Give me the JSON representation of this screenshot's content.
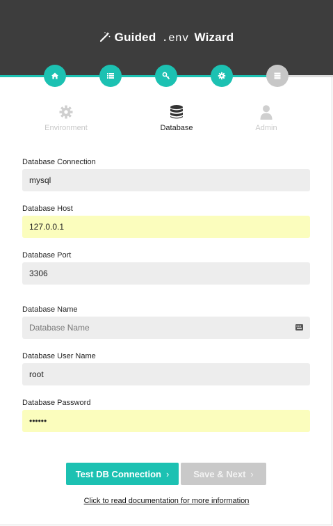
{
  "header": {
    "title_prefix": "Guided",
    "title_code": ".env",
    "title_suffix": "Wizard",
    "icon": "magic-wand-icon"
  },
  "steps": [
    {
      "icon": "home-icon",
      "active": true
    },
    {
      "icon": "list-icon",
      "active": true
    },
    {
      "icon": "key-icon",
      "active": true
    },
    {
      "icon": "gear-icon",
      "active": true
    },
    {
      "icon": "server-icon",
      "active": false
    }
  ],
  "tabs": {
    "environment": {
      "label": "Environment",
      "icon": "gear-icon"
    },
    "database": {
      "label": "Database",
      "icon": "database-icon"
    },
    "admin": {
      "label": "Admin",
      "icon": "user-icon"
    }
  },
  "form": {
    "connection": {
      "label": "Database Connection",
      "value": "mysql"
    },
    "host": {
      "label": "Database Host",
      "value": "127.0.0.1"
    },
    "port": {
      "label": "Database Port",
      "value": "3306"
    },
    "name": {
      "label": "Database Name",
      "value": "",
      "placeholder": "Database Name"
    },
    "user": {
      "label": "Database User Name",
      "value": "root"
    },
    "password": {
      "label": "Database Password",
      "value": "••••••"
    }
  },
  "actions": {
    "test_label": "Test DB Connection",
    "save_label": "Save & Next",
    "chevron": "›"
  },
  "footer": {
    "doc_link": "Click to read documentation for more information"
  },
  "colors": {
    "accent": "#1cc1b2",
    "header_bg": "#3d3d3d",
    "autofill": "#fbfdbd",
    "field_bg": "#ededed",
    "disabled": "#c9c9c9"
  }
}
